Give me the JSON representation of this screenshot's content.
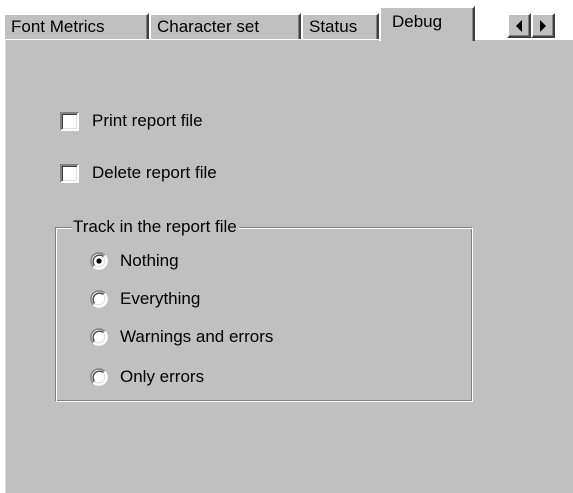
{
  "tabs": [
    {
      "label": "Font Metrics",
      "active": false
    },
    {
      "label": "Character set",
      "active": false
    },
    {
      "label": "Status",
      "active": false
    },
    {
      "label": "Debug",
      "active": true
    }
  ],
  "scroll_arrows": {
    "left_icon": "arrow-left-icon",
    "right_icon": "arrow-right-icon"
  },
  "options": {
    "print_report_file": {
      "label": "Print report file",
      "checked": false
    },
    "delete_report_file": {
      "label": "Delete report file",
      "checked": false
    }
  },
  "track_group": {
    "title": "Track in the report file",
    "selected": "Nothing",
    "choices": [
      {
        "label": "Nothing",
        "selected": true
      },
      {
        "label": "Everything",
        "selected": false
      },
      {
        "label": "Warnings and errors",
        "selected": false
      },
      {
        "label": "Only errors",
        "selected": false
      }
    ]
  },
  "colors": {
    "face": "#c0c0c0",
    "highlight": "#ffffff",
    "shadow": "#808080",
    "dark_shadow": "#404040"
  }
}
